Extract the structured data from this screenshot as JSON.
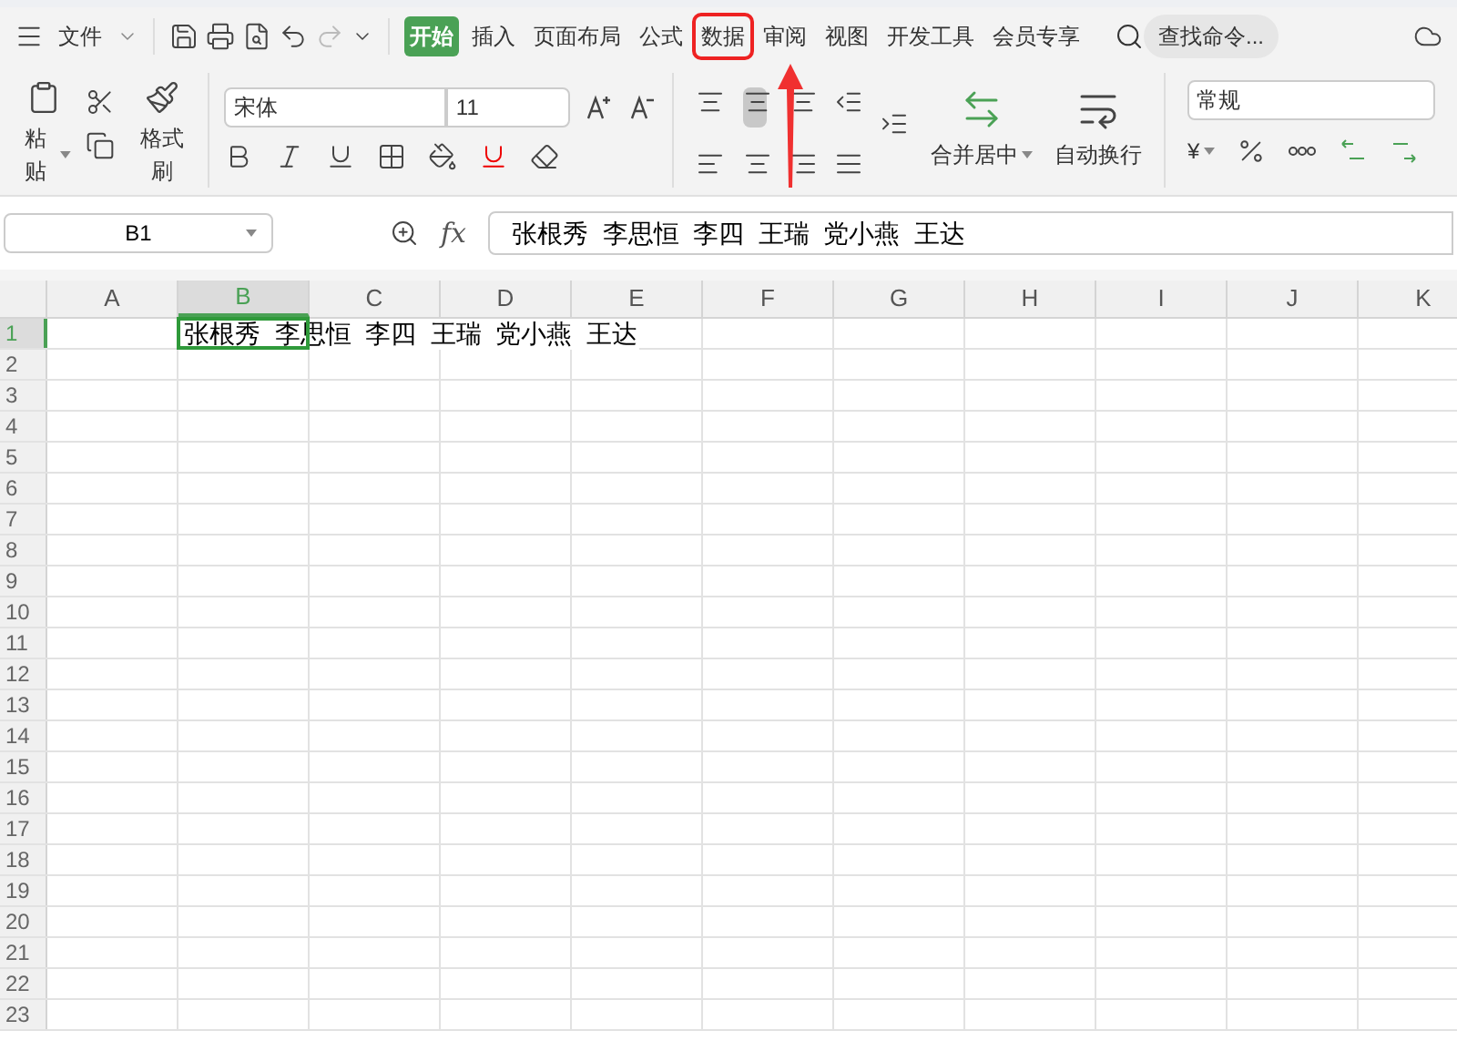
{
  "file_menu": {
    "label": "文件"
  },
  "tabs": [
    {
      "label": "开始",
      "selected": true,
      "highlighted": false
    },
    {
      "label": "插入",
      "selected": false,
      "highlighted": false
    },
    {
      "label": "页面布局",
      "selected": false,
      "highlighted": false
    },
    {
      "label": "公式",
      "selected": false,
      "highlighted": false
    },
    {
      "label": "数据",
      "selected": false,
      "highlighted": true
    },
    {
      "label": "审阅",
      "selected": false,
      "highlighted": false
    },
    {
      "label": "视图",
      "selected": false,
      "highlighted": false
    },
    {
      "label": "开发工具",
      "selected": false,
      "highlighted": false
    },
    {
      "label": "会员专享",
      "selected": false,
      "highlighted": false
    }
  ],
  "search": {
    "placeholder": "查找命令..."
  },
  "ribbon": {
    "paste": "粘贴",
    "format_painter": "格式刷",
    "font": "宋体",
    "font_size": "11",
    "merge": "合并居中",
    "wrap": "自动换行",
    "number_format": "常规",
    "currency": "¥"
  },
  "formula_bar": {
    "name_box": "B1",
    "fx": "fx",
    "value": "张根秀  李思恒  李四  王瑞  党小燕  王达"
  },
  "sheet": {
    "columns": [
      {
        "label": "A",
        "selected": false
      },
      {
        "label": "B",
        "selected": true
      },
      {
        "label": "C",
        "selected": false
      },
      {
        "label": "D",
        "selected": false
      },
      {
        "label": "E",
        "selected": false
      },
      {
        "label": "F",
        "selected": false
      },
      {
        "label": "G",
        "selected": false
      },
      {
        "label": "H",
        "selected": false
      },
      {
        "label": "I",
        "selected": false
      },
      {
        "label": "J",
        "selected": false
      },
      {
        "label": "K",
        "selected": false
      }
    ],
    "rows": [
      {
        "label": "1",
        "selected": true
      },
      {
        "label": "2",
        "selected": false
      },
      {
        "label": "3",
        "selected": false
      },
      {
        "label": "4",
        "selected": false
      },
      {
        "label": "5",
        "selected": false
      },
      {
        "label": "6",
        "selected": false
      },
      {
        "label": "7",
        "selected": false
      },
      {
        "label": "8",
        "selected": false
      },
      {
        "label": "9",
        "selected": false
      },
      {
        "label": "10",
        "selected": false
      },
      {
        "label": "11",
        "selected": false
      },
      {
        "label": "12",
        "selected": false
      },
      {
        "label": "13",
        "selected": false
      },
      {
        "label": "14",
        "selected": false
      },
      {
        "label": "15",
        "selected": false
      },
      {
        "label": "16",
        "selected": false
      },
      {
        "label": "17",
        "selected": false
      },
      {
        "label": "18",
        "selected": false
      },
      {
        "label": "19",
        "selected": false
      },
      {
        "label": "20",
        "selected": false
      },
      {
        "label": "21",
        "selected": false
      },
      {
        "label": "22",
        "selected": false
      },
      {
        "label": "23",
        "selected": false
      }
    ],
    "cell_b1": "张根秀  李思恒  李四  王瑞  党小燕  王达"
  }
}
